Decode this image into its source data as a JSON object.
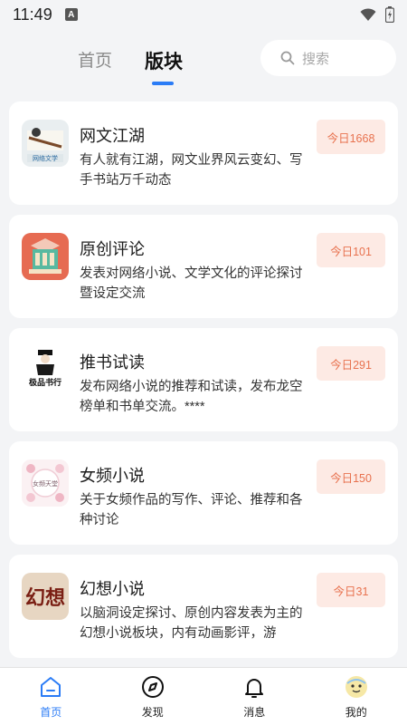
{
  "status_bar": {
    "time": "11:49",
    "notif_letter": "A"
  },
  "header": {
    "tabs": [
      {
        "label": "首页",
        "active": false
      },
      {
        "label": "版块",
        "active": true
      }
    ],
    "search": {
      "placeholder": "搜索",
      "icon": "search-icon"
    }
  },
  "colors": {
    "accent": "#2b7cf6",
    "badge_bg": "#fdeae4",
    "badge_text": "#e8724f"
  },
  "boards": [
    {
      "title": "网文江湖",
      "desc": "有人就有江湖，网文业界风云变幻、写手书站万千动态",
      "today": "今日1668",
      "icon_text": "网络文学"
    },
    {
      "title": "原创评论",
      "desc": "发表对网络小说、文学文化的评论探讨暨设定交流",
      "today": "今日101",
      "icon_text": ""
    },
    {
      "title": "推书试读",
      "desc": "发布网络小说的推荐和试读，发布龙空榜单和书单交流。****",
      "today": "今日291",
      "icon_text": "极品书行"
    },
    {
      "title": "女频小说",
      "desc": "关于女频作品的写作、评论、推荐和各种讨论",
      "today": "今日150",
      "icon_text": "女频天堂"
    },
    {
      "title": "幻想小说",
      "desc": "以脑洞设定探讨、原创内容发表为主的幻想小说板块，内有动画影评，游",
      "today": "今日31",
      "icon_text": "幻想"
    }
  ],
  "bottom_nav": [
    {
      "label": "首页",
      "icon": "home-icon",
      "active": true
    },
    {
      "label": "发现",
      "icon": "compass-icon",
      "active": false
    },
    {
      "label": "消息",
      "icon": "bell-icon",
      "active": false
    },
    {
      "label": "我的",
      "icon": "avatar-icon",
      "active": false
    }
  ]
}
